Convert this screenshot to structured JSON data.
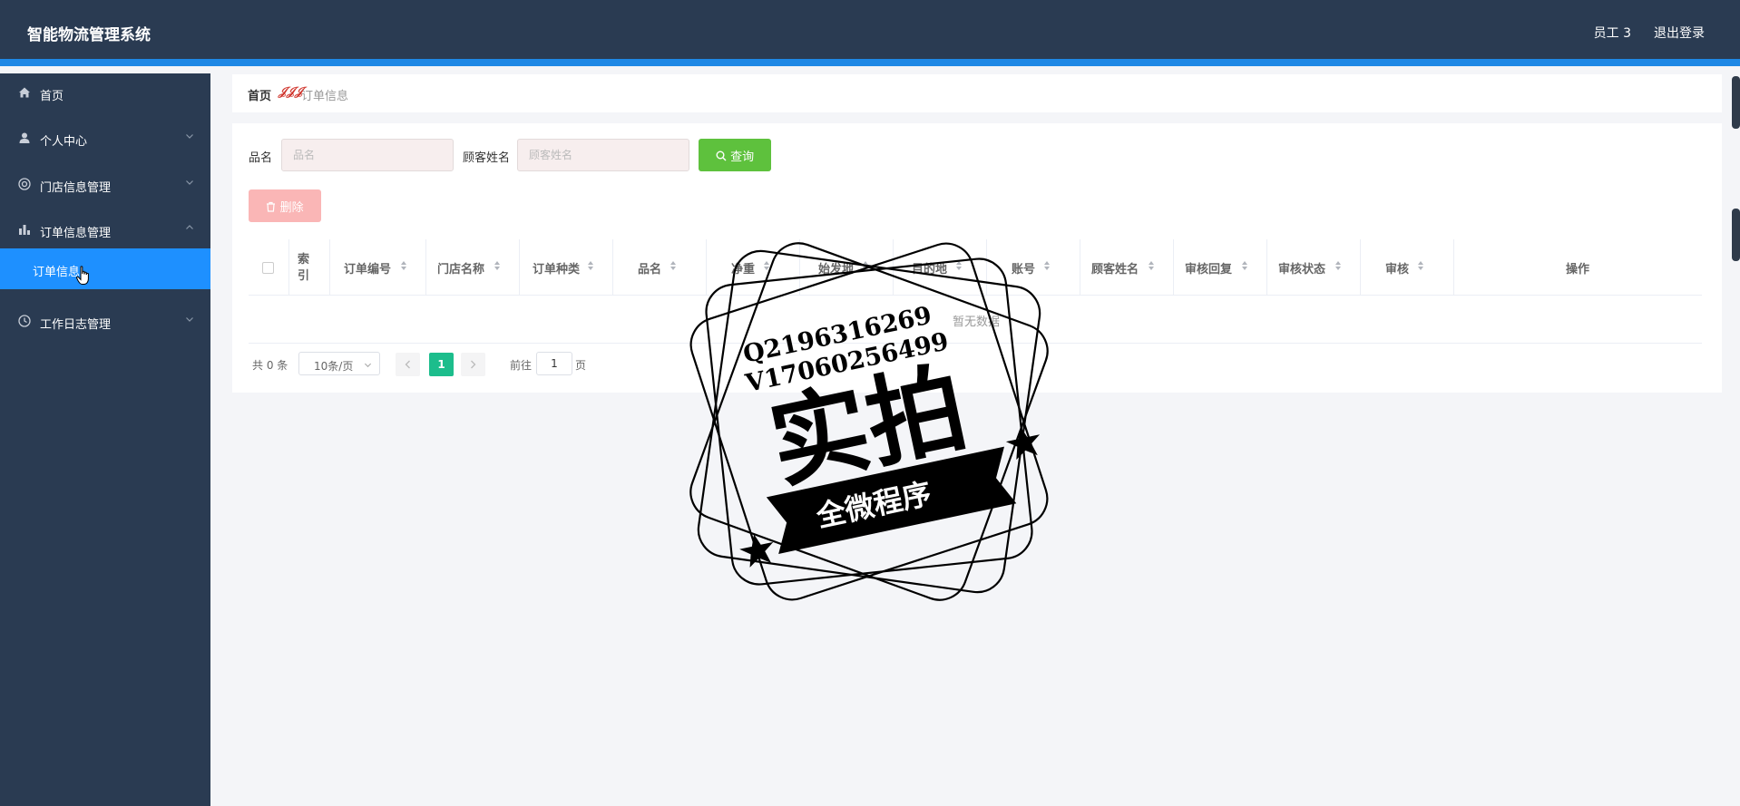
{
  "header": {
    "title": "智能物流管理系统",
    "user": "员工 3",
    "logout": "退出登录"
  },
  "sidebar": {
    "items": [
      {
        "label": "首页",
        "icon": "home-icon"
      },
      {
        "label": "个人中心",
        "icon": "user-icon"
      },
      {
        "label": "门店信息管理",
        "icon": "store-icon"
      },
      {
        "label": "订单信息管理",
        "icon": "bar-chart-icon"
      },
      {
        "label": "工作日志管理",
        "icon": "clock-icon"
      }
    ],
    "active_sub": "订单信息"
  },
  "breadcrumb": {
    "home": "首页",
    "separator": "𝒥𝒥𝒥",
    "current": "订单信息"
  },
  "search": {
    "product_label": "品名",
    "product_placeholder": "品名",
    "customer_label": "顾客姓名",
    "customer_placeholder": "顾客姓名",
    "query_button": "查询"
  },
  "actions": {
    "delete_button": "删除"
  },
  "table": {
    "index_header": "索引",
    "columns": [
      "订单编号",
      "门店名称",
      "订单种类",
      "品名",
      "净重",
      "始发地",
      "目的地",
      "账号",
      "顾客姓名",
      "审核回复",
      "审核状态",
      "审核"
    ],
    "action_header": "操作",
    "empty_text": "暂无数据"
  },
  "pagination": {
    "total": "共 0 条",
    "page_size": "10条/页",
    "current_page": "1",
    "goto_label": "前往",
    "goto_value": "1",
    "page_suffix": "页"
  },
  "watermark": {
    "line1": "Q2196316269",
    "line2": "V17060256499",
    "main": "实拍",
    "banner": "全微程序"
  },
  "colors": {
    "header_bg": "#2a3b52",
    "accent": "#1e88e5",
    "active_nav": "#1e90ff",
    "query_green": "#5ec13d",
    "delete_pink": "#fab6b6",
    "page_active": "#1cbd8c"
  }
}
